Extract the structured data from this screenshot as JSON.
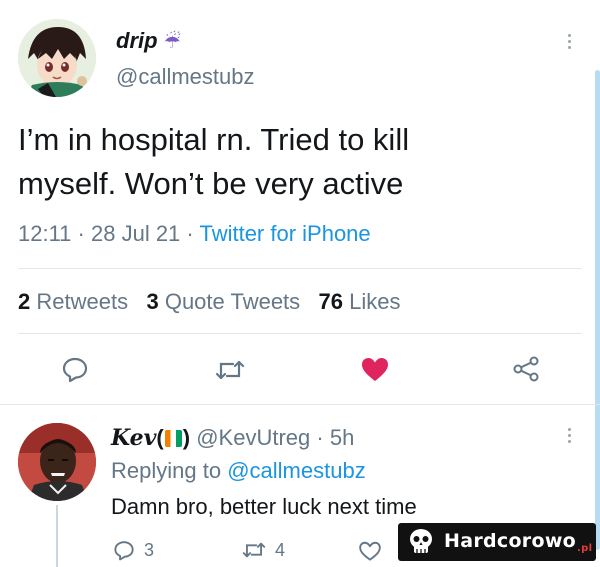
{
  "tweet": {
    "display_name": "drip",
    "name_emoji": "☔",
    "handle": "@callmestubz",
    "text_line1": "I’m in hospital rn. Tried to kill",
    "text_line2": "myself. Won’t be very active",
    "time": "12:11",
    "date": "28 Jul 21",
    "source": "Twitter for iPhone",
    "sep": "·",
    "stats": {
      "retweets_count": "2",
      "retweets_label": "Retweets",
      "quotes_count": "3",
      "quotes_label": "Quote Tweets",
      "likes_count": "76",
      "likes_label": "Likes"
    },
    "liked": true
  },
  "reply": {
    "display_name": "Kev",
    "flag_open": "(",
    "flag_close": ")",
    "handle": "@KevUtreg",
    "time": "5h",
    "replying_prefix": "Replying to",
    "replying_handle": "@callmestubz",
    "text": "Damn bro, better luck next time",
    "reply_count": "3",
    "retweet_count": "4"
  },
  "watermark": {
    "text": "Hardcorowo",
    "suffix": ".pl"
  },
  "colors": {
    "accent": "#1b95e0",
    "like": "#e0245e",
    "muted": "#657786"
  }
}
